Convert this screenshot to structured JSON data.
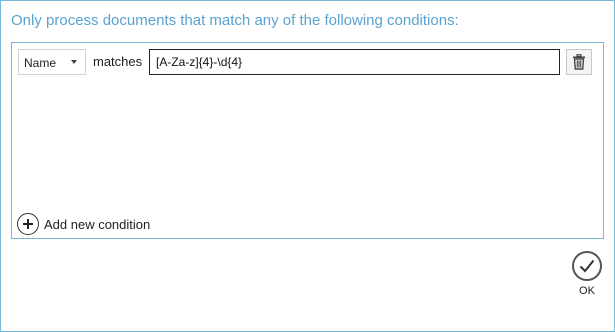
{
  "header": {
    "title": "Only process documents that match any of the following conditions:"
  },
  "condition": {
    "field": "Name",
    "operator": "matches",
    "value": "[A-Za-z]{4}-\\d{4}"
  },
  "actions": {
    "add_condition_label": "Add new condition",
    "ok_label": "OK"
  },
  "icons": {
    "delete": "trash-icon",
    "add": "plus-circle-icon",
    "ok": "checkmark-circle-icon",
    "dropdown": "chevron-down-icon"
  },
  "colors": {
    "accent": "#5aa3cf",
    "border": "#7ab8d8"
  }
}
